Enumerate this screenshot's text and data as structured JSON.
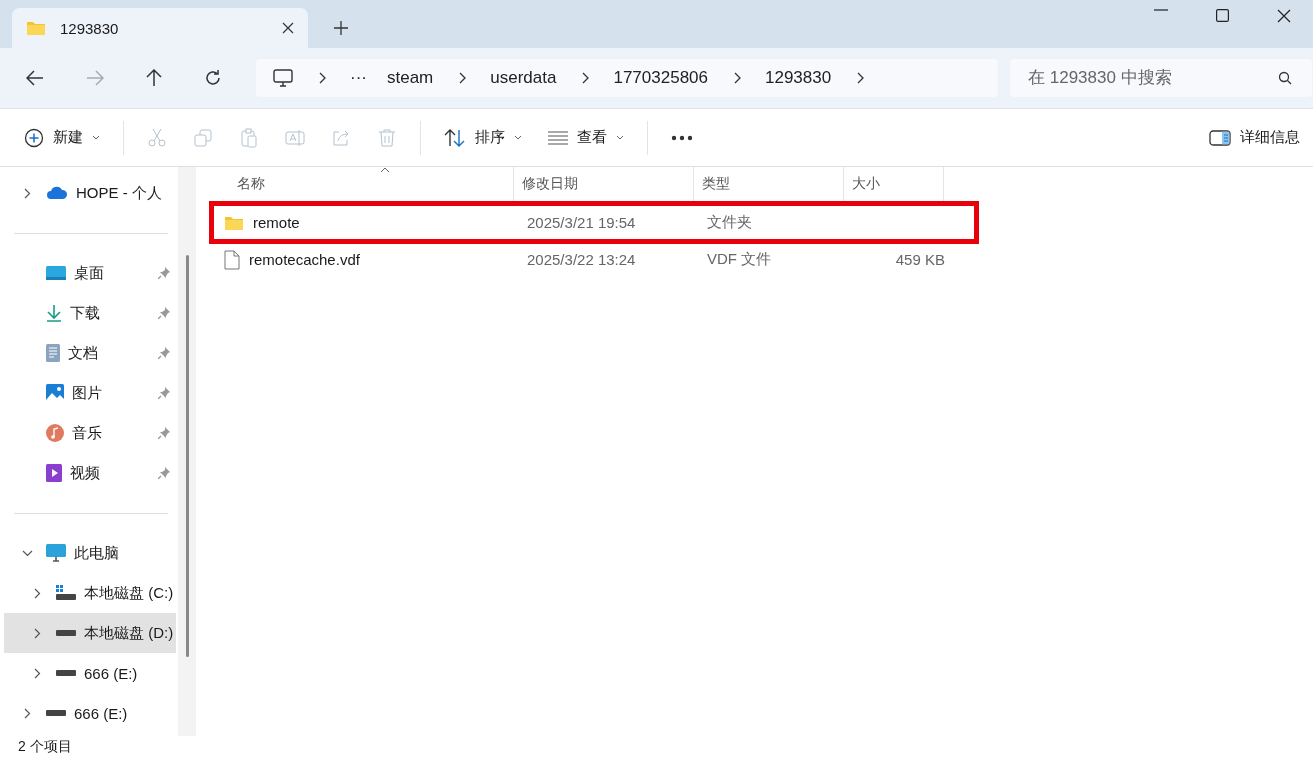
{
  "window": {
    "tabs": [
      {
        "title": "1293830",
        "selected": true
      }
    ]
  },
  "address": {
    "overflow": "···",
    "path": [
      "steam",
      "userdata",
      "1770325806",
      "1293830"
    ]
  },
  "search": {
    "placeholder": "在 1293830 中搜索"
  },
  "toolbar": {
    "buttons": [
      {
        "kind": "new",
        "label": "新建",
        "dropdown": true,
        "disabled": false
      },
      {
        "kind": "cut",
        "disabled": true
      },
      {
        "kind": "copy",
        "disabled": true
      },
      {
        "kind": "paste",
        "disabled": true
      },
      {
        "kind": "rename",
        "disabled": true
      },
      {
        "kind": "share",
        "disabled": true
      },
      {
        "kind": "delete",
        "disabled": true
      },
      {
        "kind": "sort",
        "label": "排序",
        "dropdown": true,
        "disabled": false
      },
      {
        "kind": "view",
        "label": "查看",
        "dropdown": true,
        "disabled": false
      },
      {
        "kind": "more",
        "disabled": false
      }
    ],
    "details": "详细信息"
  },
  "sidebar": {
    "sections": [
      [
        {
          "label": "HOPE - 个人",
          "kind": "cloud",
          "expanded": false,
          "selected": false
        }
      ],
      [
        {
          "label": "桌面",
          "kind": "desktop",
          "pinned": true,
          "selected": false
        },
        {
          "label": "下载",
          "kind": "download",
          "pinned": true,
          "selected": false
        },
        {
          "label": "文档",
          "kind": "document",
          "pinned": true,
          "selected": false
        },
        {
          "label": "图片",
          "kind": "pictures",
          "pinned": true,
          "selected": false
        },
        {
          "label": "音乐",
          "kind": "music",
          "pinned": true,
          "selected": false
        },
        {
          "label": "视频",
          "kind": "video",
          "pinned": true,
          "selected": false
        }
      ],
      [
        {
          "label": "此电脑",
          "kind": "pc",
          "expanded": true,
          "selected": false,
          "children": [
            {
              "label": "本地磁盘 (C:)",
              "kind": "windrive",
              "expanded": false,
              "selected": false
            },
            {
              "label": "本地磁盘 (D:)",
              "kind": "drive",
              "expanded": false,
              "selected": true
            },
            {
              "label": "666 (E:)",
              "kind": "drive",
              "expanded": false,
              "selected": false
            }
          ]
        },
        {
          "label": "666 (E:)",
          "kind": "drive",
          "expanded": false,
          "selected": false
        }
      ]
    ]
  },
  "table": {
    "columns": [
      {
        "label": "名称",
        "sorted": true
      },
      {
        "label": "修改日期",
        "sorted": false
      },
      {
        "label": "类型",
        "sorted": false
      },
      {
        "label": "大小",
        "sorted": false
      }
    ],
    "rows": [
      {
        "kind": "folder",
        "name": "remote",
        "date": "2025/3/21 19:54",
        "type": "文件夹",
        "highlighted": true
      },
      {
        "kind": "file",
        "name": "remotecache.vdf",
        "date": "2025/3/22 13:24",
        "type": "VDF 文件",
        "size": "459 KB",
        "highlighted": false
      }
    ]
  },
  "status_bar": "2 个项目"
}
